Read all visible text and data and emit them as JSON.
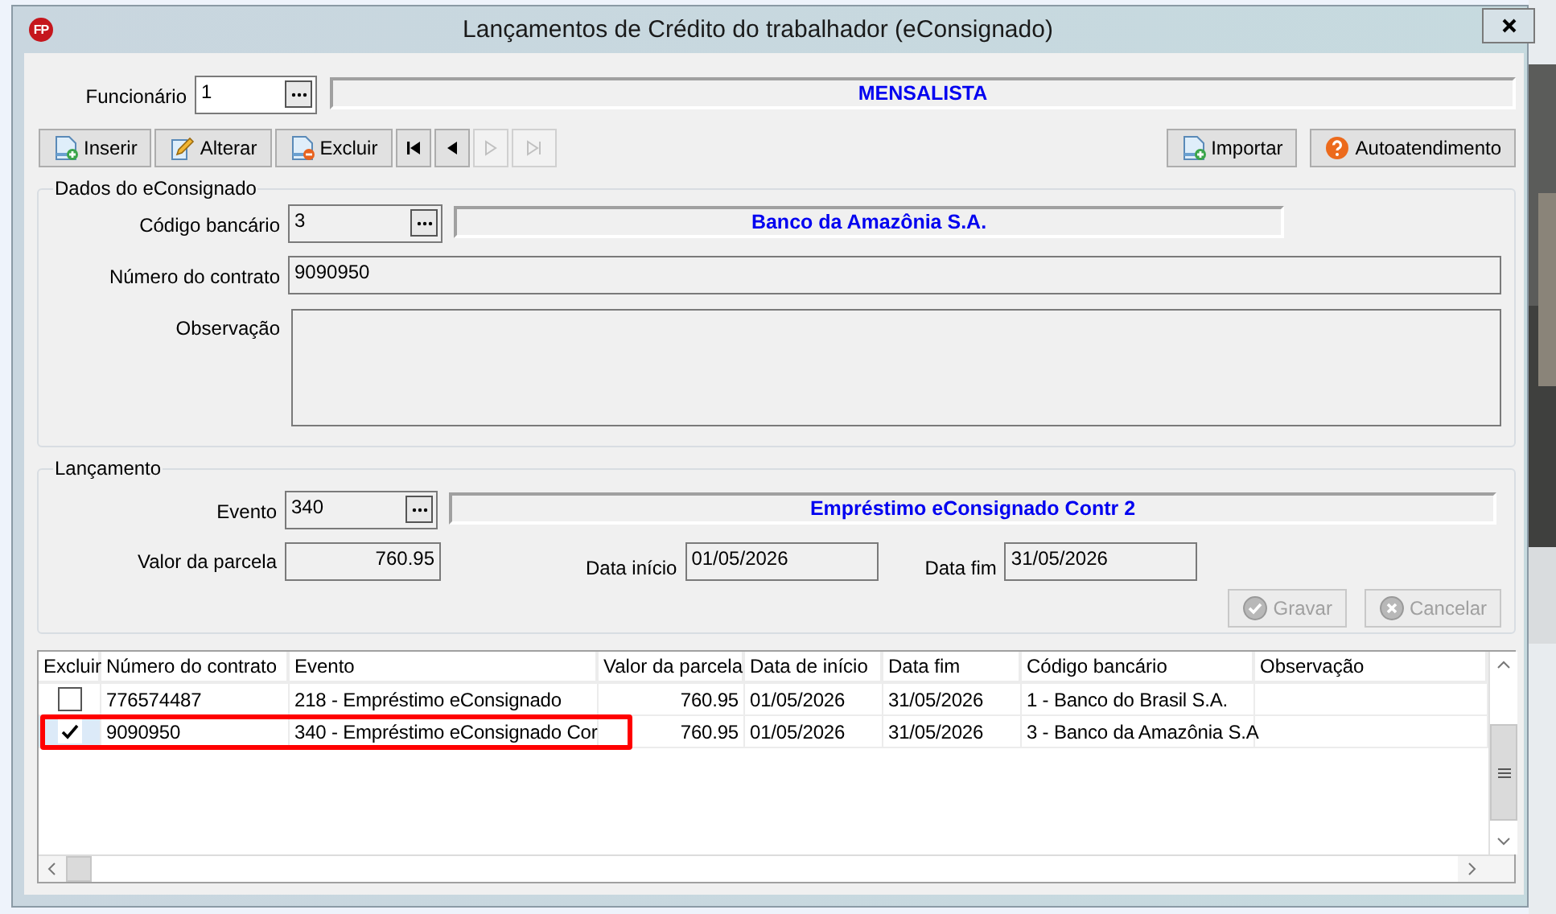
{
  "window": {
    "logo": "FP",
    "title": "Lançamentos de Crédito do trabalhador (eConsignado)"
  },
  "employee": {
    "label": "Funcionário",
    "value": "1",
    "description": "MENSALISTA"
  },
  "toolbar": [
    {
      "kind": "insert",
      "label": "Inserir",
      "disabled": false
    },
    {
      "kind": "edit",
      "label": "Alterar",
      "disabled": false
    },
    {
      "kind": "delete",
      "label": "Excluir",
      "disabled": false
    },
    {
      "kind": "first",
      "disabled": false
    },
    {
      "kind": "previous",
      "disabled": false
    },
    {
      "kind": "next",
      "disabled": true
    },
    {
      "kind": "last",
      "disabled": true
    }
  ],
  "toolbar_right": [
    {
      "kind": "import",
      "label": "Importar"
    },
    {
      "kind": "help",
      "label": "Autoatendimento"
    }
  ],
  "consignado": {
    "title": "Dados do eConsignado",
    "bank_code": {
      "label": "Código bancário",
      "value": "3",
      "description": "Banco da Amazônia S.A."
    },
    "contract": {
      "label": "Número do contrato",
      "value": "9090950"
    },
    "note": {
      "label": "Observação"
    }
  },
  "lancamento": {
    "title": "Lançamento",
    "event": {
      "label": "Evento",
      "value": "340",
      "description": "Empréstimo eConsignado Contr 2"
    },
    "installment": {
      "label": "Valor da parcela",
      "value": "760.95"
    },
    "start_date": {
      "label": "Data início",
      "value": "01/05/2026"
    },
    "end_date": {
      "label": "Data fim",
      "value": "31/05/2026"
    },
    "buttons": [
      {
        "kind": "save",
        "label": "Gravar",
        "disabled": true
      },
      {
        "kind": "cancel",
        "label": "Cancelar",
        "disabled": true
      }
    ]
  },
  "table": {
    "columns": [
      "Excluir",
      "Número do contrato",
      "Evento",
      "Valor da parcela",
      "Data de início",
      "Data fim",
      "Código bancário",
      "Observação"
    ],
    "rows": [
      {
        "checked": false,
        "highlighted": false,
        "cells": [
          "",
          "776574487",
          "218 - Empréstimo eConsignado",
          "760.95",
          "01/05/2026",
          "31/05/2026",
          "1 - Banco do Brasil S.A."
        ]
      },
      {
        "checked": true,
        "highlighted": true,
        "cells": [
          "",
          "9090950",
          "340 - Empréstimo eConsignado Cor",
          "760.95",
          "01/05/2026",
          "31/05/2026",
          "3 - Banco da Amazônia S.A"
        ]
      }
    ]
  }
}
